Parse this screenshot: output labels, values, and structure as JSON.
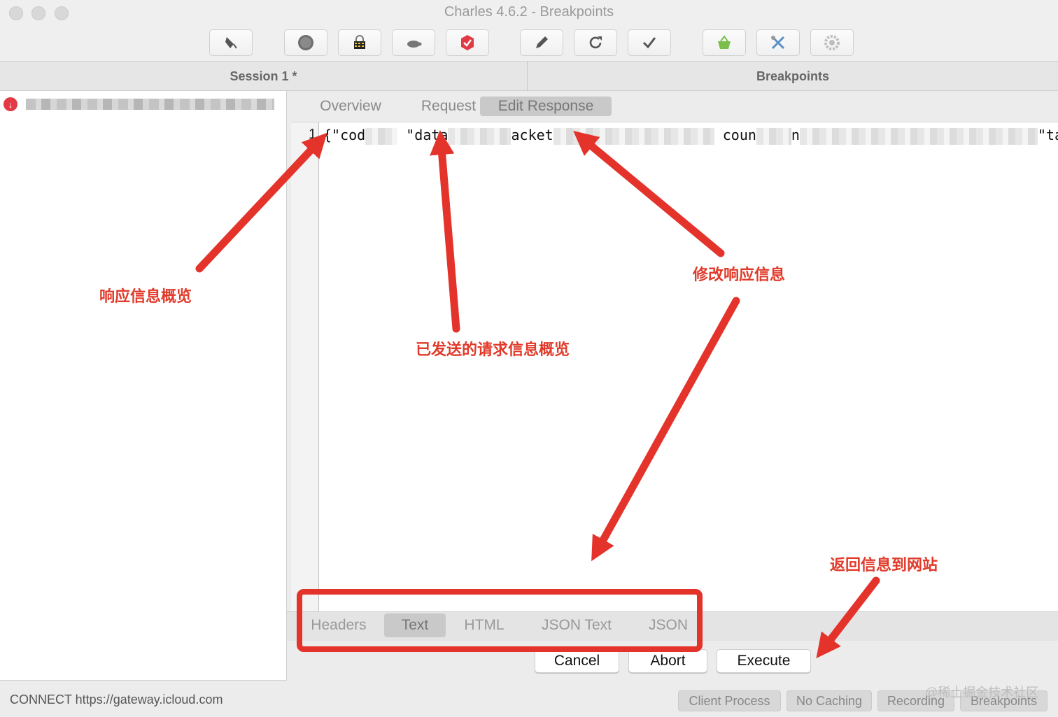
{
  "window": {
    "title": "Charles 4.6.2 - Breakpoints"
  },
  "toolbar": {
    "buttons": [
      {
        "icon": "broom-icon"
      },
      {
        "icon": "record-icon"
      },
      {
        "icon": "ssl-lock-icon"
      },
      {
        "icon": "throttle-turtle-icon"
      },
      {
        "icon": "breakpoints-hexagon-icon"
      },
      {
        "icon": "compose-pen-icon"
      },
      {
        "icon": "repeat-icon"
      },
      {
        "icon": "validate-check-icon"
      },
      {
        "icon": "basket-icon"
      },
      {
        "icon": "tools-icon"
      },
      {
        "icon": "settings-gear-icon"
      }
    ]
  },
  "session": {
    "left_tab": "Session 1 *",
    "right_tab": "Breakpoints"
  },
  "detail_tabs": [
    "Overview",
    "Request",
    "Edit Response"
  ],
  "detail_active_tab": "Edit Response",
  "editor": {
    "line_number": "1",
    "snippets": [
      "{\"cod",
      "\"data",
      "acket",
      "coun",
      "n",
      "\"tas"
    ]
  },
  "view_tabs": [
    "Headers",
    "Text",
    "HTML",
    "JSON Text",
    "JSON"
  ],
  "view_active_tab": "Text",
  "actions": {
    "cancel": "Cancel",
    "abort": "Abort",
    "execute": "Execute"
  },
  "status": {
    "text": "CONNECT https://gateway.icloud.com",
    "pills": [
      "Client Process",
      "No Caching",
      "Recording",
      "Breakpoints"
    ]
  },
  "watermark": "@稀土掘金技术社区",
  "annotations": {
    "overview": "响应信息概览",
    "request": "已发送的请求信息概览",
    "edit_response": "修改响应信息",
    "return": "返回信息到网站"
  },
  "colors": {
    "annotation": "#e4332a",
    "active_tab": "#c9c9c9",
    "breakpoint": "#e13a44"
  }
}
